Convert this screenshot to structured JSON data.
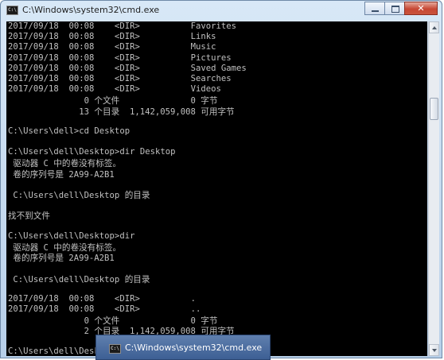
{
  "window": {
    "title": "C:\\Windows\\system32\\cmd.exe",
    "icon_label": "C:\\",
    "close_label": "✕"
  },
  "console_lines": [
    "2017/09/18  00:08    <DIR>          Favorites",
    "2017/09/18  00:08    <DIR>          Links",
    "2017/09/18  00:08    <DIR>          Music",
    "2017/09/18  00:08    <DIR>          Pictures",
    "2017/09/18  00:08    <DIR>          Saved Games",
    "2017/09/18  00:08    <DIR>          Searches",
    "2017/09/18  00:08    <DIR>          Videos",
    "               0 个文件              0 字节",
    "              13 个目录  1,142,059,008 可用字节",
    "",
    "C:\\Users\\dell>cd Desktop",
    "",
    "C:\\Users\\dell\\Desktop>dir Desktop",
    " 驱动器 C 中的卷没有标签。",
    " 卷的序列号是 2A99-A2B1",
    "",
    " C:\\Users\\dell\\Desktop 的目录",
    "",
    "找不到文件",
    "",
    "C:\\Users\\dell\\Desktop>dir",
    " 驱动器 C 中的卷没有标签。",
    " 卷的序列号是 2A99-A2B1",
    "",
    " C:\\Users\\dell\\Desktop 的目录",
    "",
    "2017/09/18  00:08    <DIR>          .",
    "2017/09/18  00:08    <DIR>          ..",
    "               0 个文件              0 字节",
    "               2 个目录  1,142,059,008 可用字节",
    "",
    "C:\\Users\\dell\\Desktop>"
  ],
  "taskbar_popup": {
    "title": "C:\\Windows\\system32\\cmd.exe",
    "icon_label": "C:\\"
  }
}
